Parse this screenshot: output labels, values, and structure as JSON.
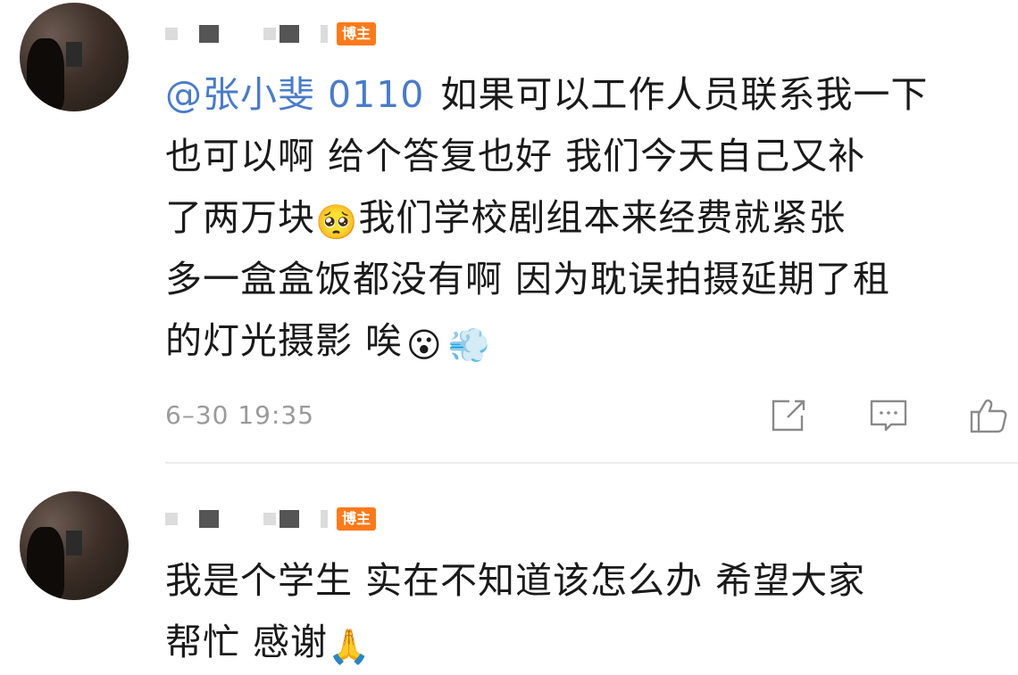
{
  "comments": [
    {
      "badge": "博主",
      "mention": "@张小斐 0110",
      "lines": [
        "如果可以工作人员联系我一下",
        "也可以啊 给个答复也好 我们今天自己又补",
        "了两万块",
        "我们学校剧组本来经费就紧张",
        "多一盒盒饭都没有啊 因为耽误拍摄延期了租",
        "的灯光摄影 唉"
      ],
      "emojis": [
        "🥺",
        "😮",
        "💨"
      ],
      "time": "6–30 19:35",
      "icons": [
        "share-icon",
        "comment-icon",
        "like-icon"
      ]
    },
    {
      "badge": "博主",
      "lines": [
        "我是个学生 实在不知道该怎么办 希望大家",
        "帮忙 感谢"
      ],
      "emojis": [
        "🙏"
      ]
    }
  ]
}
